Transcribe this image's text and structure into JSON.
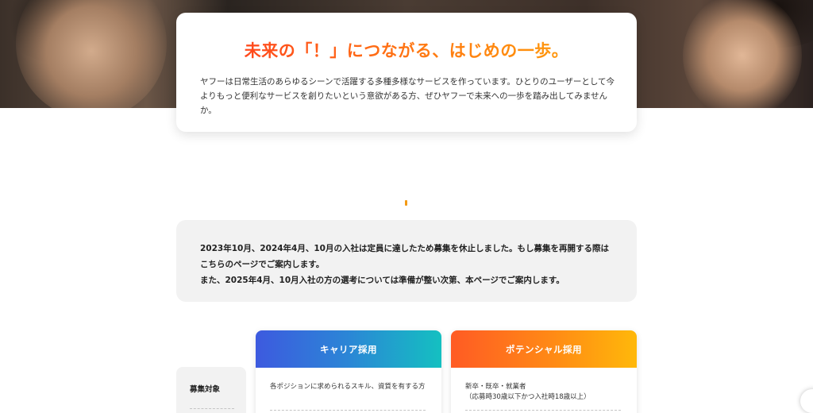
{
  "intro": {
    "title": "未来の「！」につながる、はじめの一歩。",
    "text": "ヤフーは日常生活のあらゆるシーンで活躍する多種多様なサービスを作っています。ひとりのユーザーとして今よりもっと便利なサービスを創りたいという意欲がある方、ぜひヤフーで未来への一歩を踏み出してみませんか。"
  },
  "notice": {
    "line1": "2023年10月、2024年4月、10月の入社は定員に達したため募集を休止しました。もし募集を再開する際は",
    "line2": "こちらのページでご案内します。",
    "line3": "また、2025年4月、10月入社の方の選考については準備が整い次第、本ページでご案内します。"
  },
  "table": {
    "row_label": "募集対象",
    "career": {
      "title": "キャリア採用",
      "target": "各ポジションに求められるスキル、資質を有する方"
    },
    "potential": {
      "title": "ポテンシャル採用",
      "target_line1": "新卒・既卒・就業者",
      "target_line2": "（応募時30歳以下かつ入社時18歳以上）"
    }
  },
  "colors": {
    "title_gradient": [
      "#ff3d1f",
      "#ffa20a"
    ],
    "career_gradient": [
      "#3d5adf",
      "#14c0c1"
    ],
    "potential_gradient": [
      "#ff5b24",
      "#ffb80a"
    ],
    "panel_bg": "#f2f2f2"
  },
  "icons": {
    "accent": "accent-mark"
  }
}
